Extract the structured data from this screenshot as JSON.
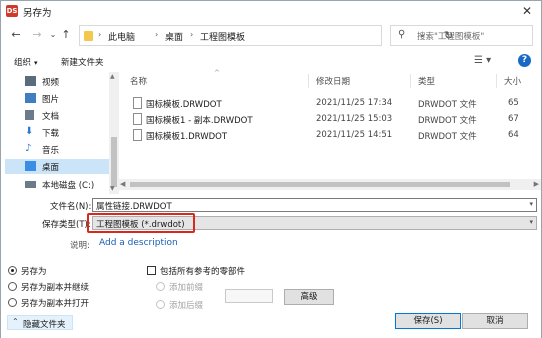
{
  "window": {
    "title": "另存为",
    "app_icon_text": "DS",
    "close": "✕"
  },
  "nav": {
    "back": "←",
    "forward": "→",
    "dropdown": "⌄",
    "up": "↑",
    "breadcrumbs": [
      "此电脑",
      "桌面",
      "工程图模板"
    ],
    "crumb_separator": "›",
    "address_dropdown": "⌄",
    "refresh": "↻",
    "search_placeholder": "搜索\"工程图模板\""
  },
  "toolbar": {
    "organize": "组织",
    "organize_caret": "▾",
    "new_folder": "新建文件夹",
    "view": "☰ ▾",
    "help": "?"
  },
  "sidebar": {
    "items": [
      {
        "label": "视频",
        "icon": "video-icon",
        "color": "#5a6b7c"
      },
      {
        "label": "图片",
        "icon": "picture-icon",
        "color": "#3f7fbf"
      },
      {
        "label": "文档",
        "icon": "document-icon",
        "color": "#6b7b8c"
      },
      {
        "label": "下载",
        "icon": "download-icon",
        "color": "#2a7ad5"
      },
      {
        "label": "音乐",
        "icon": "music-icon",
        "color": "#2a7ad5"
      },
      {
        "label": "桌面",
        "icon": "desktop-icon",
        "color": "#3a8ee6"
      },
      {
        "label": "本地磁盘 (C:)",
        "icon": "drive-icon",
        "color": "#6b7b8c"
      }
    ],
    "selected_index": 5
  },
  "file_list": {
    "columns": {
      "name": "名称",
      "date": "修改日期",
      "type": "类型",
      "size": "大小"
    },
    "sort_indicator": "^",
    "rows": [
      {
        "name": "国标模板.DRWDOT",
        "date": "2021/11/25 17:34",
        "type": "DRWDOT 文件",
        "size": "65"
      },
      {
        "name": "国标模板1 - 副本.DRWDOT",
        "date": "2021/11/25 15:03",
        "type": "DRWDOT 文件",
        "size": "67"
      },
      {
        "name": "国标模板1.DRWDOT",
        "date": "2021/11/25 14:51",
        "type": "DRWDOT 文件",
        "size": "64"
      }
    ]
  },
  "form": {
    "filename_label": "文件名(N):",
    "filename_value": "属性链接.DRWDOT",
    "filetype_label": "保存类型(T):",
    "filetype_value": "工程图模板 (*.drwdot)",
    "description_label": "说明:",
    "description_link": "Add a description",
    "highlight_color": "#d9281e"
  },
  "options": {
    "radios": [
      "另存为",
      "另存为副本并继续",
      "另存为副本并打开"
    ],
    "selected_radio": 0,
    "include_refs": "包括所有参考的零部件",
    "add_prefix": "添加前缀",
    "add_suffix": "添加后缀",
    "advanced": "高级"
  },
  "buttons": {
    "save": "保存(S)",
    "cancel": "取消",
    "hide_folders": "隐藏文件夹",
    "hide_caret": "⌃"
  }
}
